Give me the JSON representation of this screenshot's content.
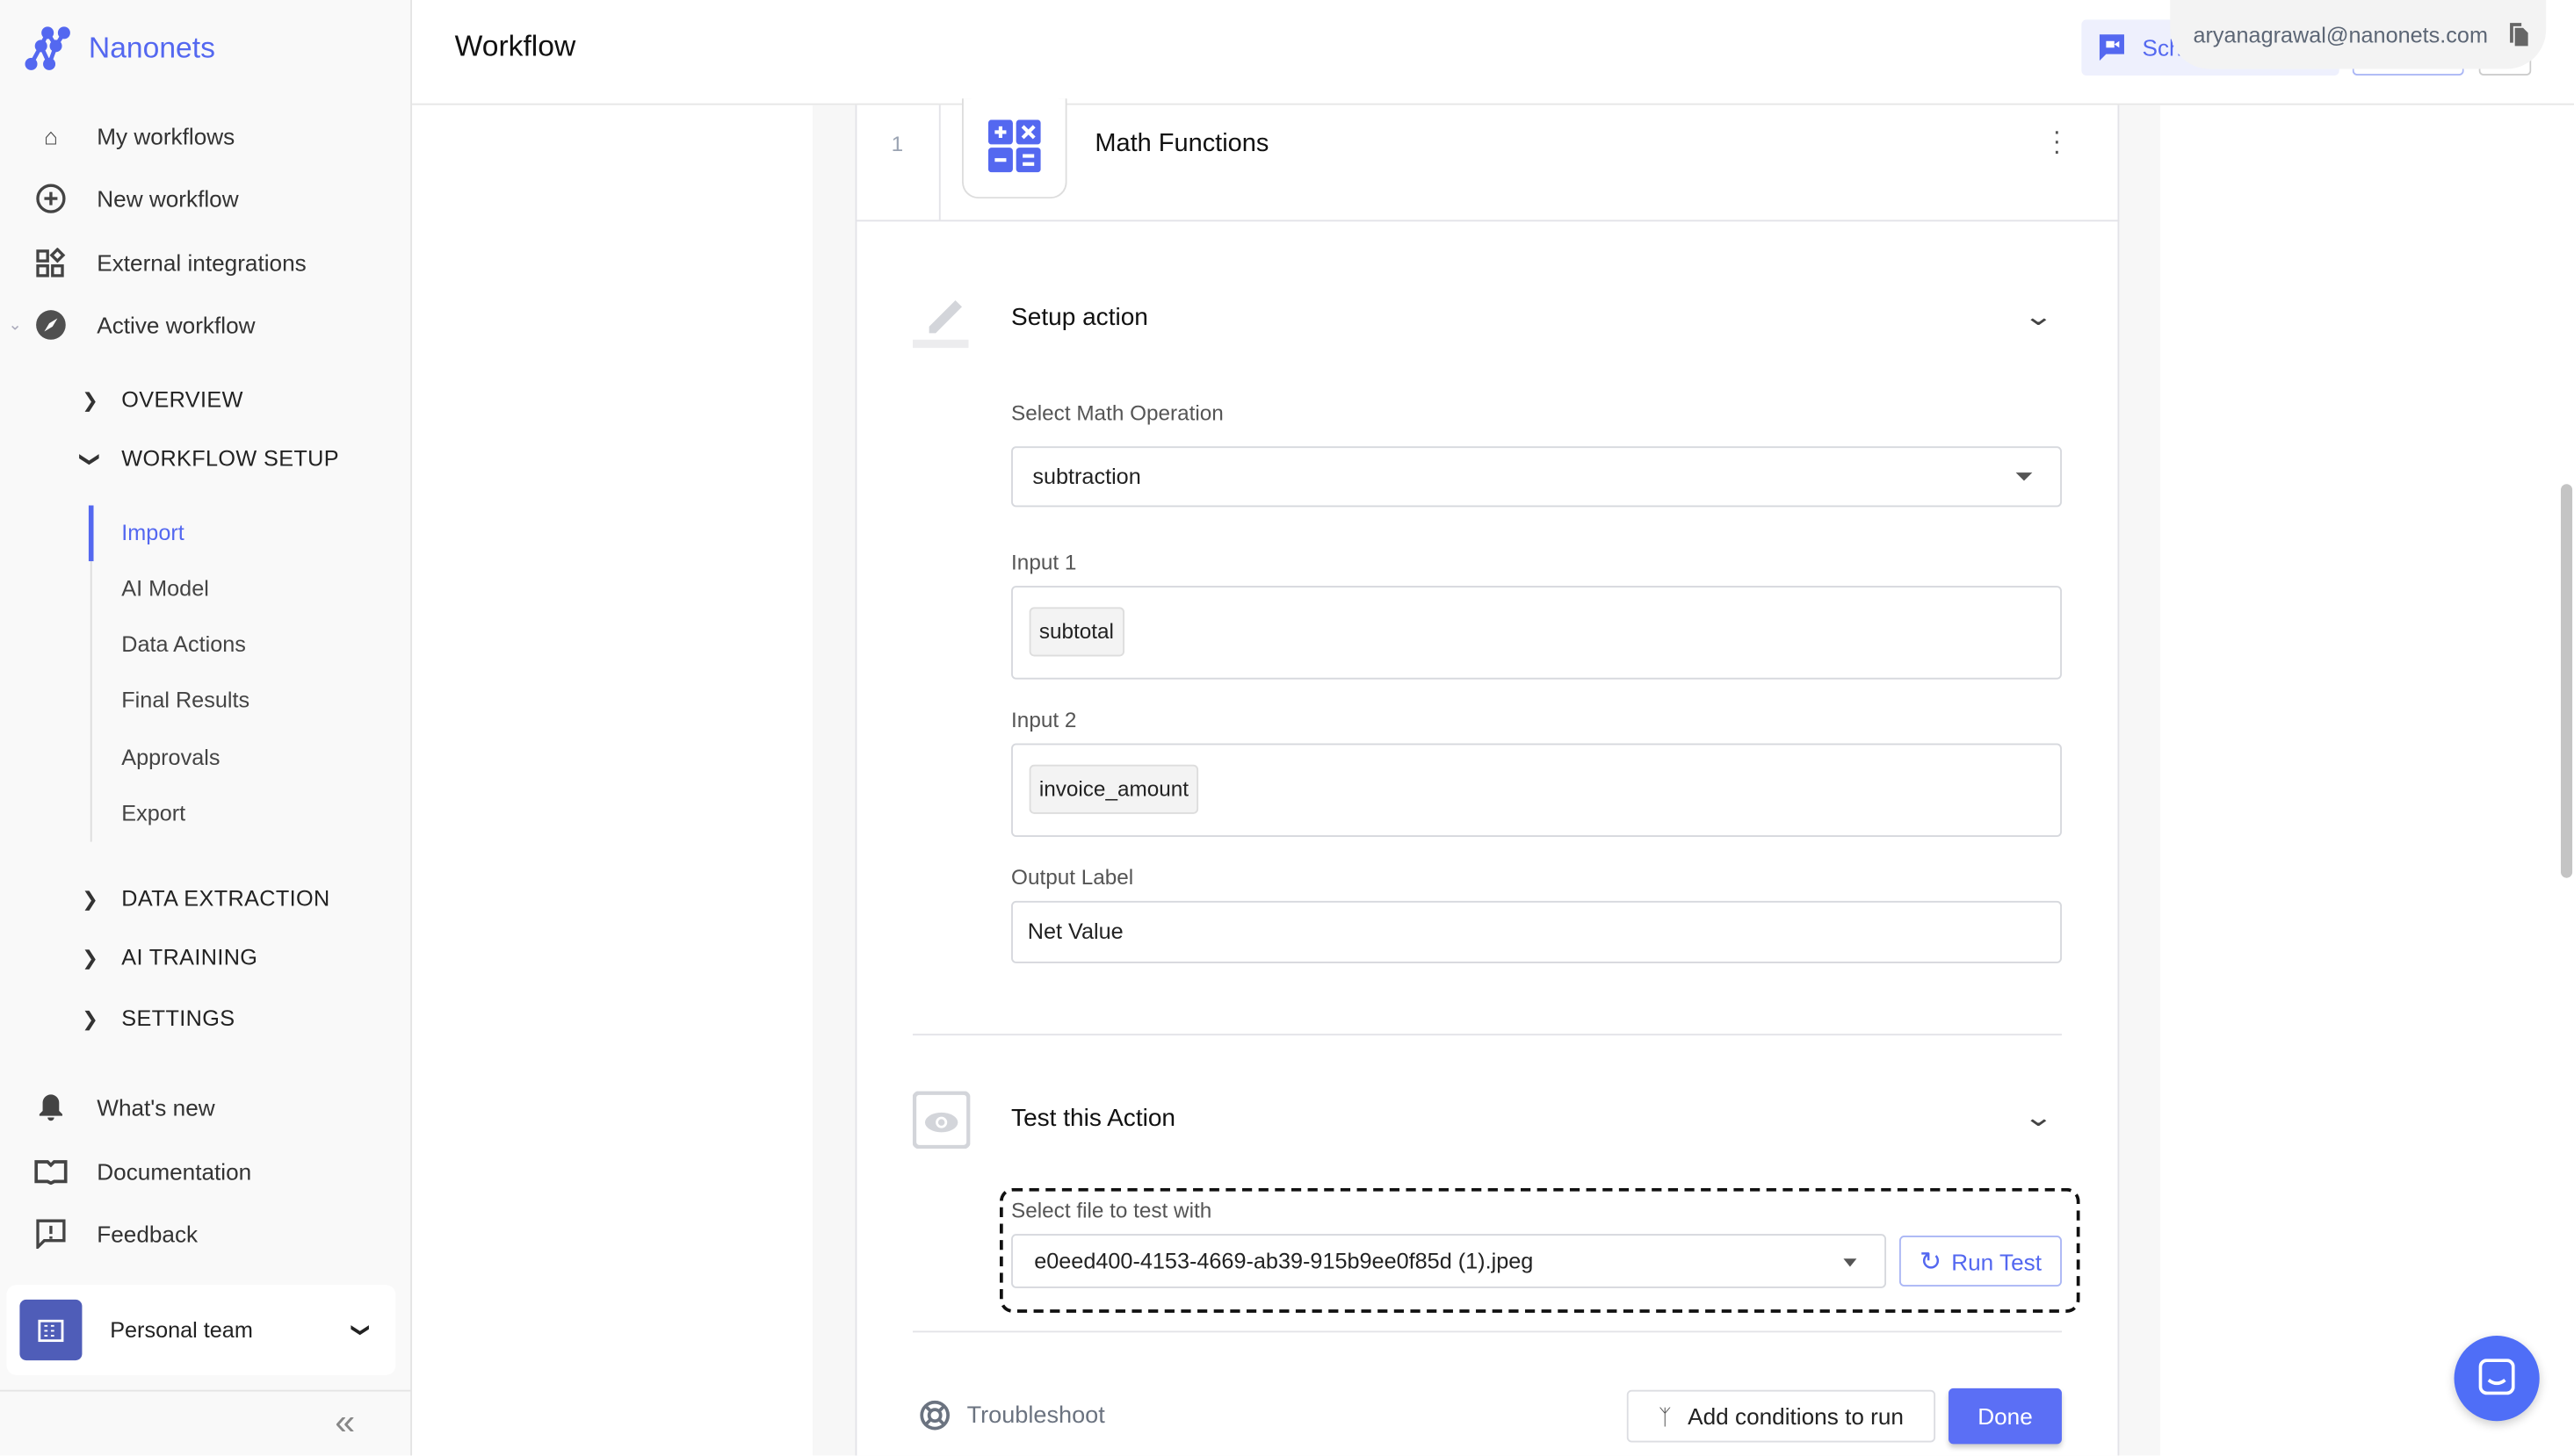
{
  "brand": {
    "name": "Nanonets",
    "color": "#5468f0"
  },
  "sidebar": {
    "items": [
      {
        "label": "My workflows",
        "icon": "home-icon"
      },
      {
        "label": "New workflow",
        "icon": "plus-circle-icon"
      },
      {
        "label": "External integrations",
        "icon": "widgets-icon"
      },
      {
        "label": "Active workflow",
        "icon": "compass-icon"
      }
    ],
    "sections": [
      {
        "label": "OVERVIEW",
        "expanded": false
      },
      {
        "label": "WORKFLOW SETUP",
        "expanded": true
      },
      {
        "label": "DATA EXTRACTION",
        "expanded": false
      },
      {
        "label": "AI TRAINING",
        "expanded": false
      },
      {
        "label": "SETTINGS",
        "expanded": false
      }
    ],
    "setup_items": [
      {
        "label": "Import",
        "active": true
      },
      {
        "label": "AI Model"
      },
      {
        "label": "Data Actions"
      },
      {
        "label": "Final Results"
      },
      {
        "label": "Approvals"
      },
      {
        "label": "Export"
      }
    ],
    "bottom_items": [
      {
        "label": "What's new",
        "icon": "bell-icon"
      },
      {
        "label": "Documentation",
        "icon": "book-icon"
      },
      {
        "label": "Feedback",
        "icon": "feedback-icon"
      }
    ],
    "team": {
      "label": "Personal team"
    }
  },
  "header": {
    "title": "Workflow",
    "schedule_label": "Sch",
    "email": "aryanagrawal@nanonets.com"
  },
  "card": {
    "step_number": "1",
    "title": "Math Functions",
    "setup": {
      "title": "Setup action",
      "operation_label": "Select Math Operation",
      "operation_value": "subtraction",
      "input1_label": "Input 1",
      "input1_value": "subtotal",
      "input2_label": "Input 2",
      "input2_value": "invoice_amount",
      "output_label": "Output Label",
      "output_value": "Net Value"
    },
    "test": {
      "title": "Test this Action",
      "file_label": "Select file to test with",
      "file_value": "e0eed400-4153-4669-ab39-915b9ee0f85d (1).jpeg",
      "run_label": "Run Test"
    },
    "footer": {
      "troubleshoot": "Troubleshoot",
      "conditions": "Add conditions to run",
      "done": "Done"
    }
  },
  "colors": {
    "accent": "#5468f0",
    "sidebar_bg": "#f9f9f9"
  }
}
